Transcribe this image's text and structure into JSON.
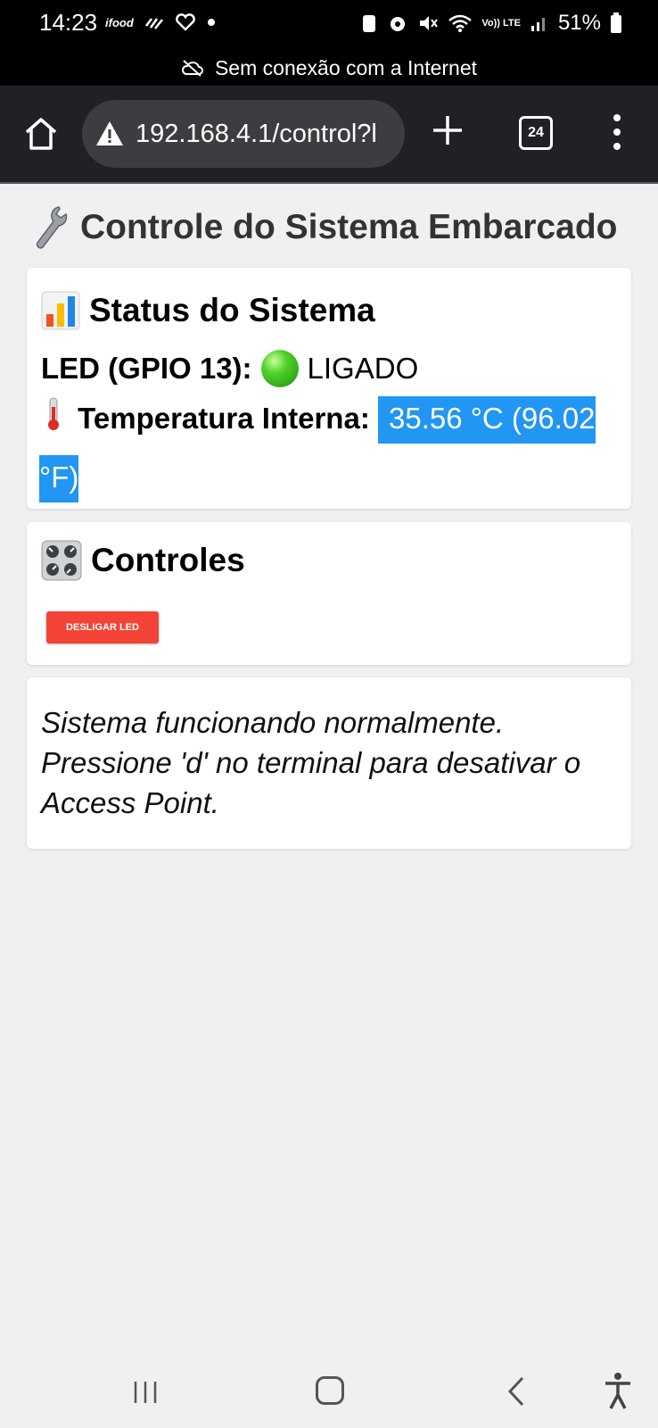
{
  "status_bar": {
    "time": "14:23",
    "ifood_label": "ifood",
    "battery": "51%",
    "network_label": "Vo)) LTE"
  },
  "offline_banner": {
    "text": "Sem conexão com a Internet"
  },
  "browser": {
    "url": "192.168.4.1/control?l",
    "tab_count": "24"
  },
  "page": {
    "title": "Controle do Sistema Embarcado",
    "status_card": {
      "heading": "Status do Sistema",
      "led_label": "LED (GPIO 13):",
      "led_state": "LIGADO",
      "temp_label": "Temperatura Interna:",
      "temp_value": "35.56 °C (96.02 °F)"
    },
    "controls_card": {
      "heading": "Controles",
      "button_label": "DESLIGAR LED"
    },
    "message": "Sistema funcionando normalmente. Pressione 'd' no terminal para desativar o Access Point."
  },
  "colors": {
    "selection": "#2196f3",
    "button": "#f44336",
    "led_on": "#4fd12a"
  },
  "icons": [
    "wrench-icon",
    "bar-chart-icon",
    "thermometer-icon",
    "control-knobs-icon",
    "green-circle-icon"
  ]
}
